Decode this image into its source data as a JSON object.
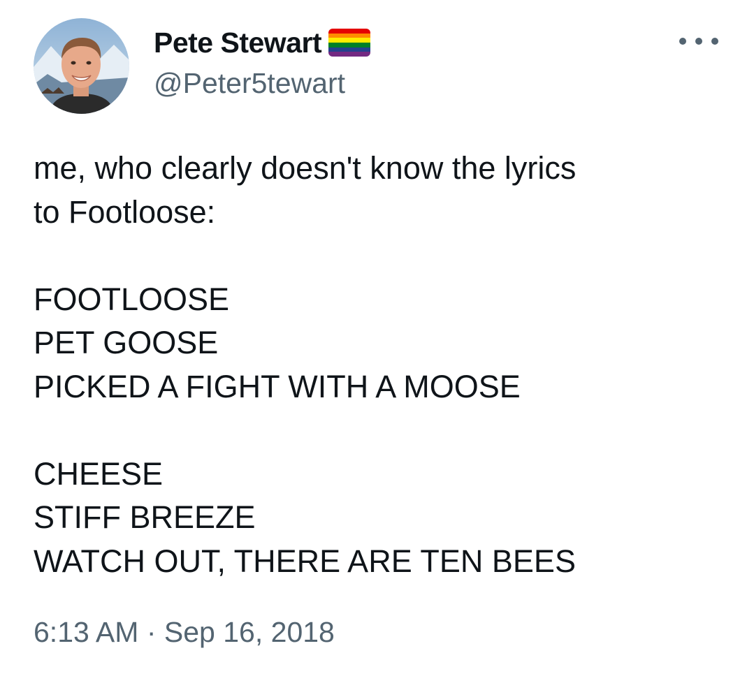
{
  "tweet": {
    "author": {
      "display_name": "Pete Stewart",
      "handle": "@Peter5tewart",
      "badge_icon": "rainbow-flag-icon"
    },
    "menu_icon": "more-options-icon",
    "text_lines": [
      "me, who clearly doesn't know the lyrics",
      "to Footloose:",
      "",
      "FOOTLOOSE",
      "PET GOOSE",
      "PICKED A FIGHT WITH A MOOSE",
      "",
      "CHEESE",
      "STIFF BREEZE",
      "WATCH OUT, THERE ARE TEN BEES"
    ],
    "time": "6:13 AM",
    "separator": "·",
    "date": "Sep 16, 2018"
  },
  "colors": {
    "text_primary": "#0f1419",
    "text_secondary": "#536471",
    "background": "#ffffff",
    "flag_stripes": [
      "#e40303",
      "#ff8c00",
      "#ffed00",
      "#008026",
      "#24408e",
      "#732982"
    ]
  }
}
